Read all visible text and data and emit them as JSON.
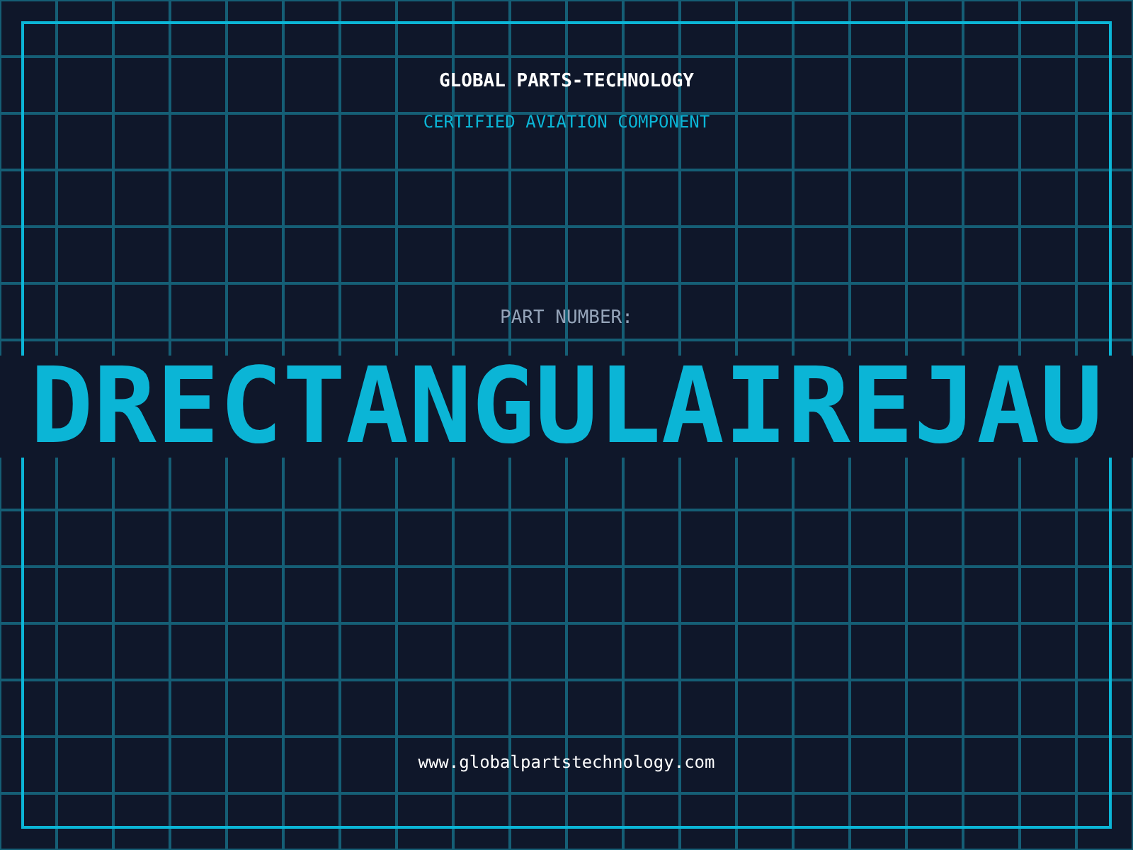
{
  "company": "GLOBAL PARTS-TECHNOLOGY",
  "subtitle": "CERTIFIED AVIATION COMPONENT",
  "part_label": "PART NUMBER:",
  "part_number": "DRECTANGULAIREJAU",
  "website": "www.globalpartstechnology.com"
}
